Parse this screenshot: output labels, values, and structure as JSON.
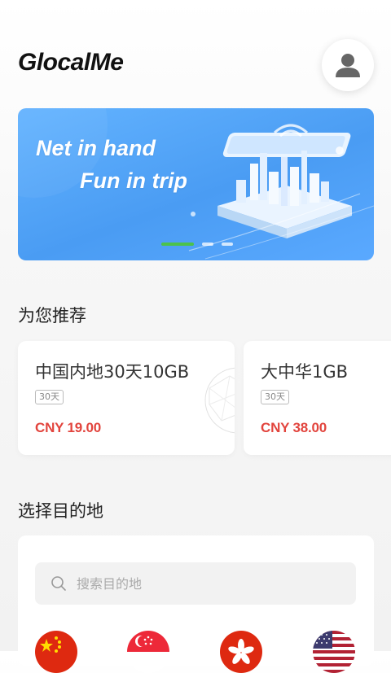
{
  "header": {
    "app_name": "GlocalMe",
    "avatar_icon": "user-icon"
  },
  "banner": {
    "line1": "Net in hand",
    "line2": "Fun in trip",
    "slides": 3,
    "active_slide": 1,
    "accent": "#4cc24c"
  },
  "recommend": {
    "title": "为您推荐",
    "items": [
      {
        "name": "中国内地30天10GB",
        "tag": "30天",
        "price": "CNY 19.00"
      },
      {
        "name": "大中华1GB",
        "tag": "30天",
        "price": "CNY 38.00"
      }
    ],
    "price_color": "#e2443d"
  },
  "destination": {
    "title": "选择目的地",
    "search_placeholder": "搜索目的地",
    "flags": [
      "china-flag-icon",
      "singapore-flag-icon",
      "hong-kong-flag-icon",
      "usa-flag-icon"
    ]
  }
}
